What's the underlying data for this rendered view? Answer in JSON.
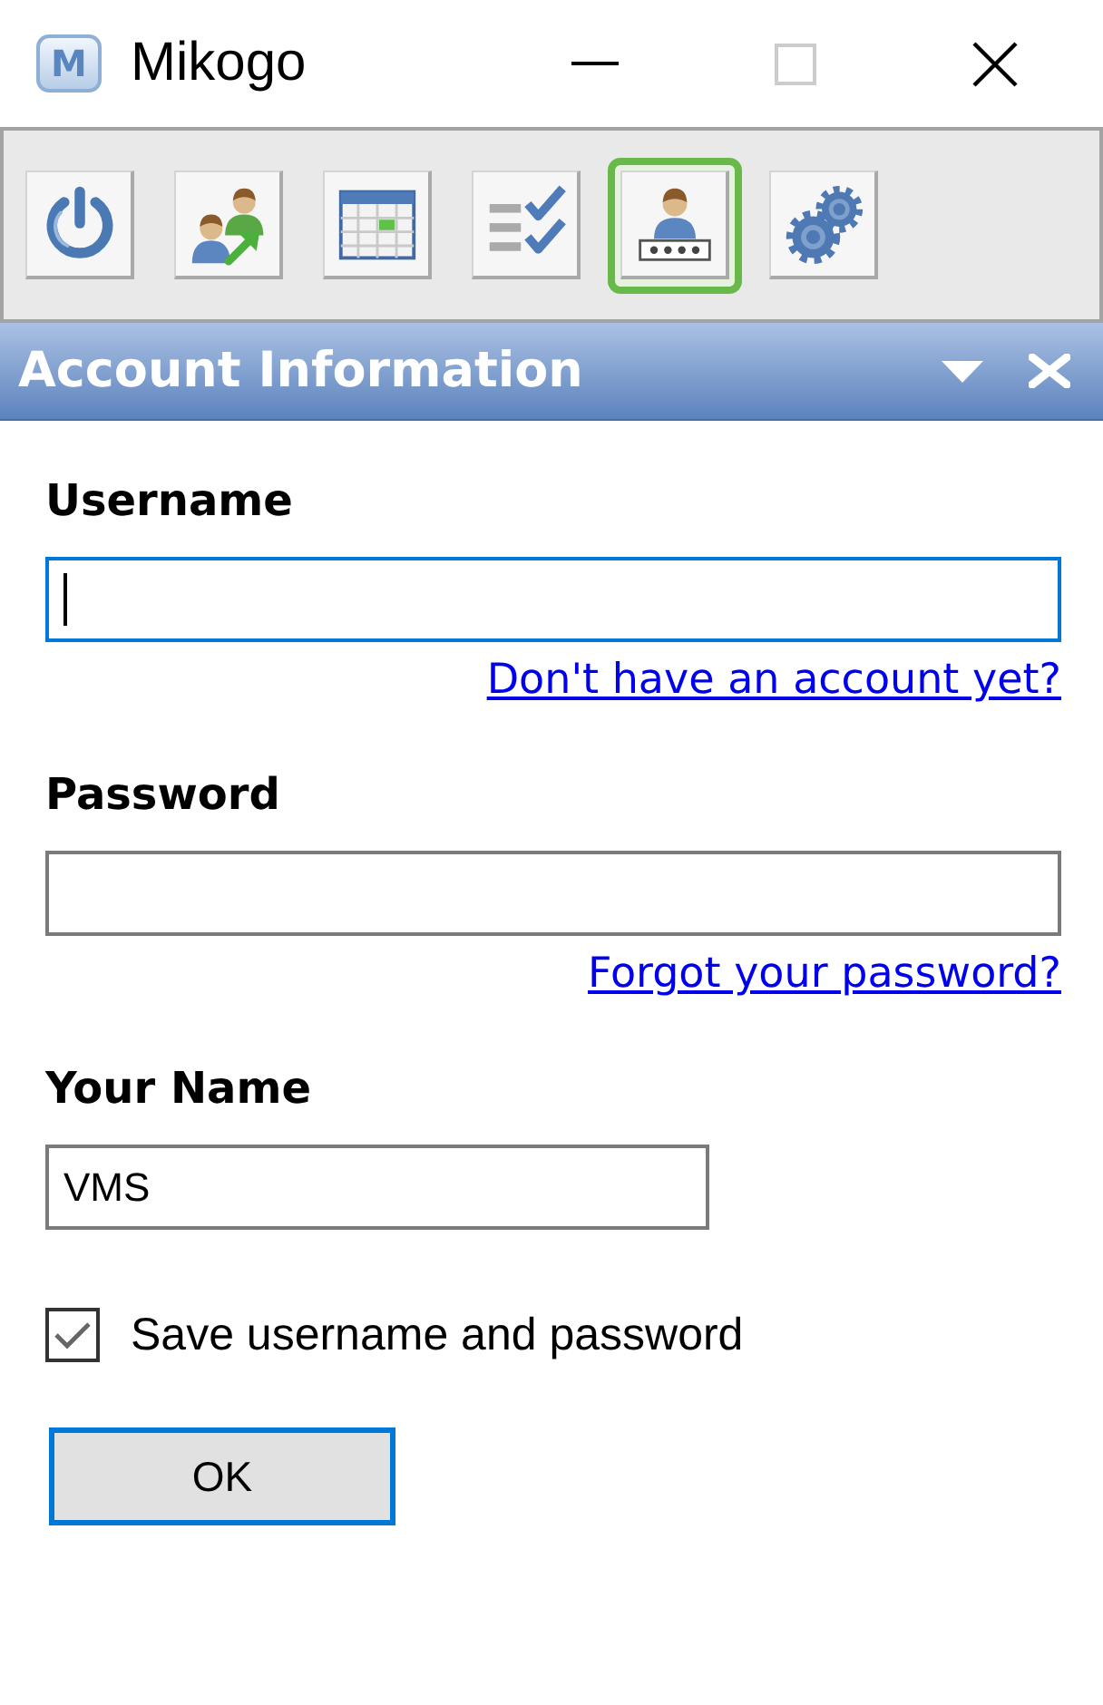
{
  "window": {
    "logo_text": "M",
    "title": "Mikogo",
    "controls": [
      {
        "kind": "minimize",
        "disabled": false
      },
      {
        "kind": "maximize",
        "disabled": true
      },
      {
        "kind": "close",
        "disabled": false
      }
    ]
  },
  "toolbar": {
    "tools": [
      {
        "kind": "power",
        "selected": false
      },
      {
        "kind": "transfer",
        "selected": false
      },
      {
        "kind": "calendar",
        "selected": false
      },
      {
        "kind": "checklist",
        "selected": false
      },
      {
        "kind": "account",
        "selected": true
      },
      {
        "kind": "settings",
        "selected": false
      }
    ]
  },
  "panel": {
    "title": "Account Information"
  },
  "form": {
    "username": {
      "label": "Username",
      "focused": true,
      "link": "Don't have an account yet?"
    },
    "password": {
      "label": "Password",
      "focused": false,
      "link": "Forgot your password?"
    },
    "your_name": {
      "label": "Your Name",
      "value": "VMS",
      "focused": false
    },
    "save_credentials": {
      "label": "Save username and password",
      "checked": true
    },
    "ok_button": {
      "label": "OK",
      "default": true
    }
  }
}
